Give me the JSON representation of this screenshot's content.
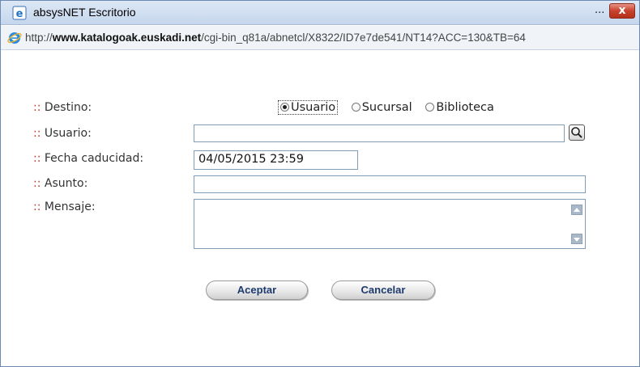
{
  "window": {
    "title": "absysNET Escritorio",
    "dots": "...",
    "close_label": "x"
  },
  "address": {
    "url_prefix": "http://",
    "url_host": "www.katalogoak.euskadi.net",
    "url_path": "/cgi-bin_q81a/abnetcl/X8322/ID7e7de541/NT14?ACC=130&TB=64"
  },
  "form": {
    "bullet": "::",
    "destino_label": "Destino:",
    "usuario_label": "Usuario:",
    "fecha_label": "Fecha caducidad:",
    "asunto_label": "Asunto:",
    "mensaje_label": "Mensaje:",
    "destino_options": [
      "Usuario",
      "Sucursal",
      "Biblioteca"
    ],
    "destino_selected": "Usuario",
    "usuario_value": "",
    "fecha_value": "04/05/2015 23:59",
    "asunto_value": "",
    "mensaje_value": ""
  },
  "buttons": {
    "accept": "Aceptar",
    "cancel": "Cancelar"
  },
  "icons": {
    "title": "ie-page-icon",
    "address": "ie-logo-icon",
    "search": "magnifier-icon"
  }
}
